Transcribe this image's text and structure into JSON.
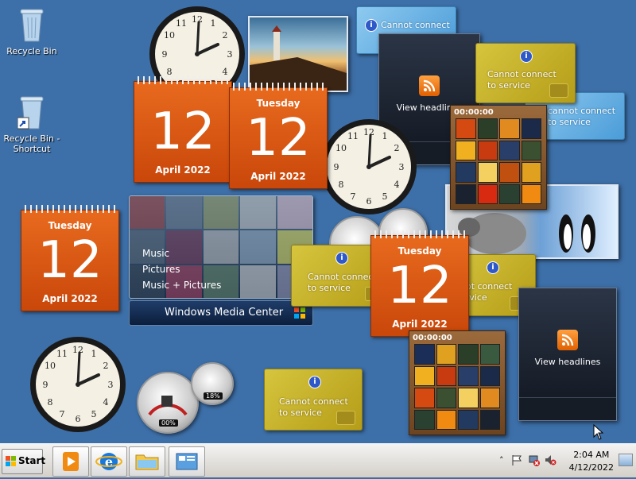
{
  "desktop_icons": [
    {
      "label": "Recycle Bin"
    },
    {
      "label": "Recycle Bin - Shortcut"
    }
  ],
  "calendars": [
    {
      "dow": "",
      "day": "12",
      "month": "April 2022"
    },
    {
      "dow": "Tuesday",
      "day": "12",
      "month": "April 2022"
    },
    {
      "dow": "Tuesday",
      "day": "12",
      "month": "April 2022"
    },
    {
      "dow": "Tuesday",
      "day": "12",
      "month": "April 2022"
    }
  ],
  "feeds": [
    {
      "label": "View headlines"
    },
    {
      "label": "View headlines"
    }
  ],
  "weather": [
    {
      "message": "Cannot connect",
      "message2": ""
    },
    {
      "message": "Cannot connect",
      "message2": "to service"
    },
    {
      "message": "cannot connect",
      "message2": "to service"
    },
    {
      "message": "Cannot connect",
      "message2": "to service"
    },
    {
      "message": "not connect",
      "message2": "ervice"
    },
    {
      "message": "Cannot connect",
      "message2": "to service"
    }
  ],
  "puzzles": [
    {
      "timer": "00:00:00"
    },
    {
      "timer": "00:00:00"
    }
  ],
  "media_center": {
    "menu": [
      "Music",
      "Pictures",
      "Music + Pictures"
    ],
    "brand": "Windows Media Center"
  },
  "meters": [
    {
      "value": "00%"
    },
    {
      "value": "18%"
    }
  ],
  "taskbar": {
    "start_label": "Start",
    "time": "2:04 AM",
    "date": "4/12/2022"
  },
  "colors": {
    "desktop": "#3d6fa8",
    "calendar": "#e0601a",
    "weather": "#c9b22a"
  }
}
